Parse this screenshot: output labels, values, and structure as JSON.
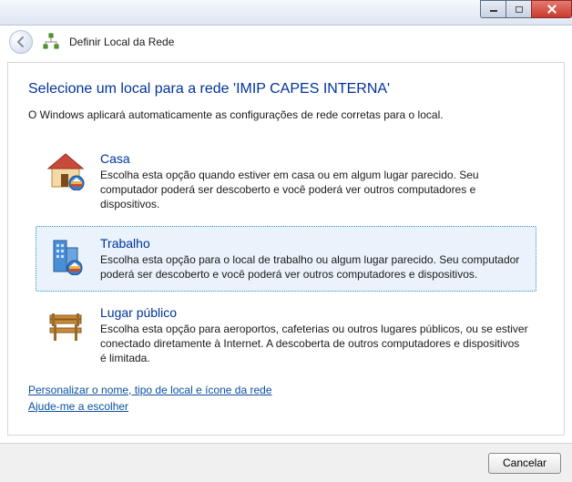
{
  "window": {
    "header_title": "Definir Local da Rede"
  },
  "page": {
    "heading": "Selecione um local para a rede 'IMIP CAPES INTERNA'",
    "subtext": "O Windows aplicará automaticamente as configurações de rede corretas para o local."
  },
  "options": [
    {
      "id": "home",
      "title": "Casa",
      "desc": "Escolha esta opção quando estiver em casa ou em algum lugar parecido. Seu computador poderá ser descoberto e você poderá ver outros computadores e dispositivos.",
      "selected": false
    },
    {
      "id": "work",
      "title": "Trabalho",
      "desc": "Escolha esta opção para o local de trabalho ou algum lugar parecido. Seu computador poderá ser descoberto e você poderá ver outros computadores e dispositivos.",
      "selected": true
    },
    {
      "id": "public",
      "title": "Lugar público",
      "desc": "Escolha esta opção para aeroportos, cafeterias ou outros lugares públicos, ou se estiver conectado diretamente à Internet. A descoberta de outros computadores e dispositivos é limitada.",
      "selected": false
    }
  ],
  "links": {
    "customize": "Personalizar o nome, tipo de local e ícone da rede",
    "help": "Ajude-me a escolher"
  },
  "footer": {
    "cancel": "Cancelar"
  }
}
